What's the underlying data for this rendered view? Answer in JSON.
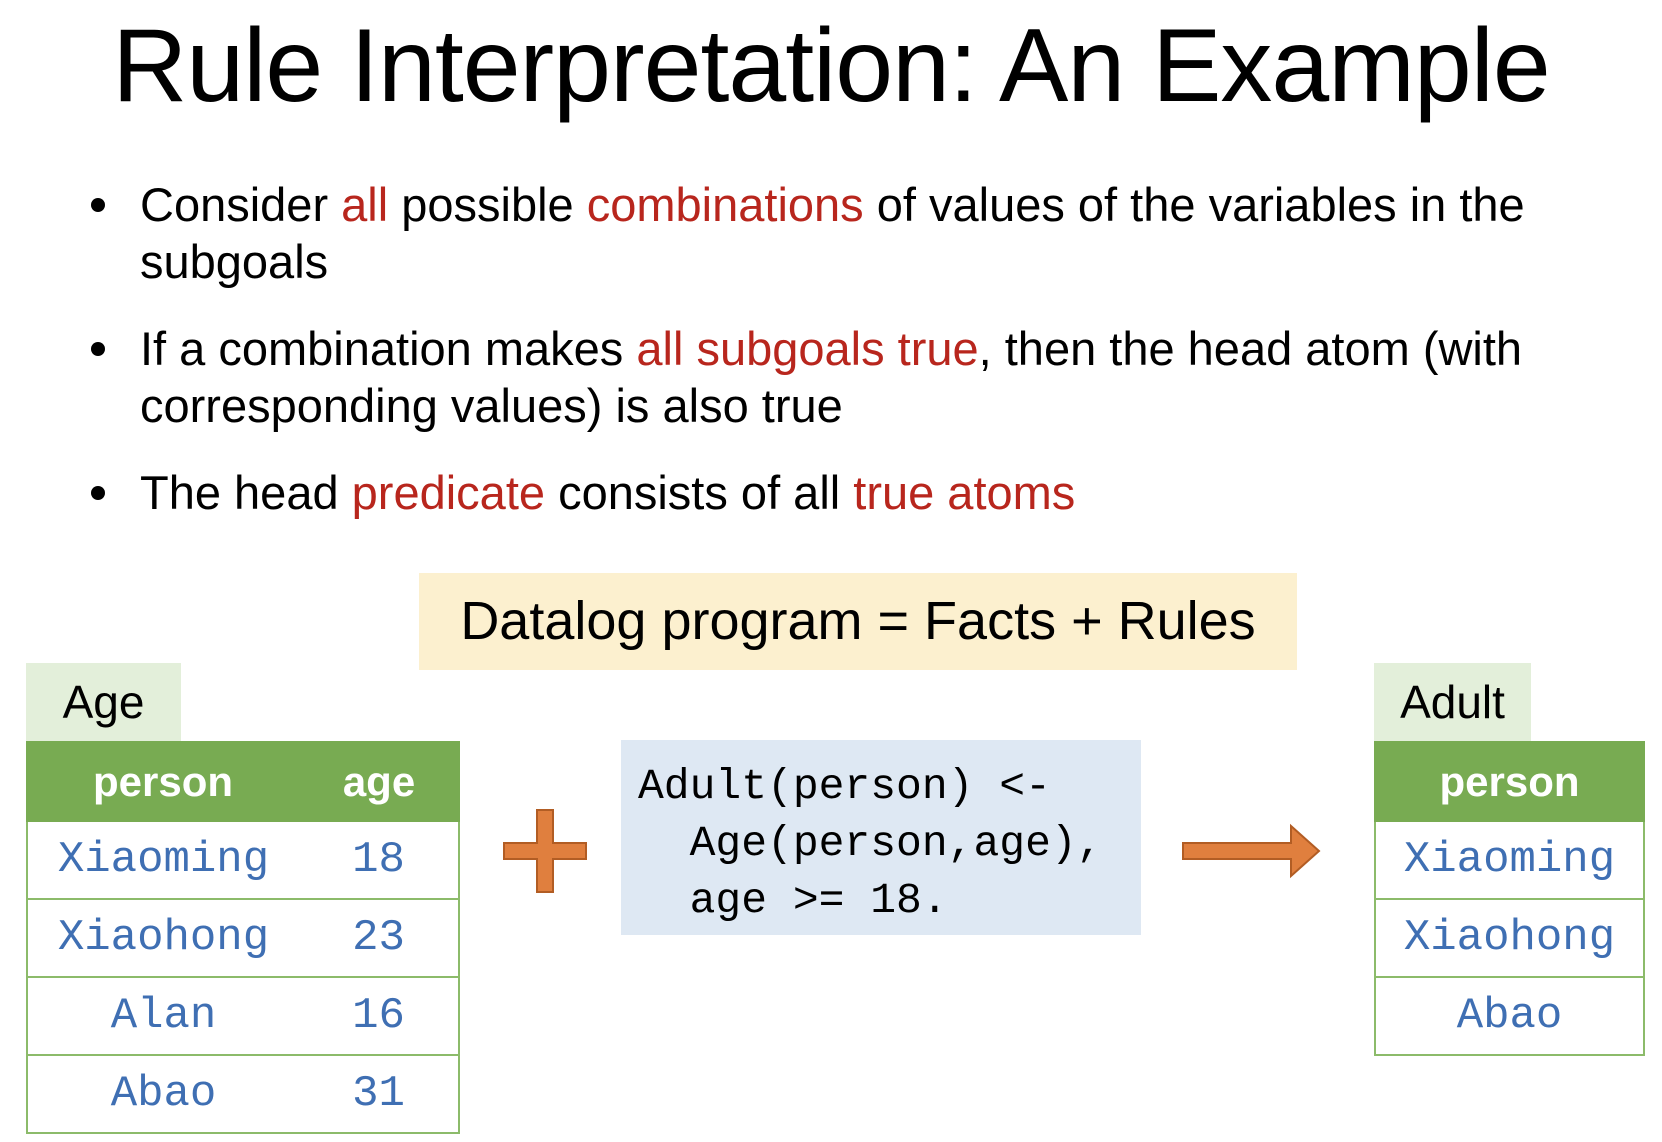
{
  "slide": {
    "title": "Rule Interpretation: An Example",
    "bullets": [
      [
        {
          "text": "Consider ",
          "emph": false
        },
        {
          "text": "all",
          "emph": true
        },
        {
          "text": " possible ",
          "emph": false
        },
        {
          "text": "combinations",
          "emph": true
        },
        {
          "text": " of values of the variables in the subgoals",
          "emph": false
        }
      ],
      [
        {
          "text": "If a combination makes ",
          "emph": false
        },
        {
          "text": "all subgoals true",
          "emph": true
        },
        {
          "text": ", then the head atom (with corresponding values) is also true",
          "emph": false
        }
      ],
      [
        {
          "text": "The head ",
          "emph": false
        },
        {
          "text": "predicate",
          "emph": true
        },
        {
          "text": " consists of all ",
          "emph": false
        },
        {
          "text": "true atoms",
          "emph": true
        }
      ]
    ],
    "banner": "Datalog program = Facts + Rules",
    "age_table": {
      "tab": "Age",
      "headers": [
        "person",
        "age"
      ],
      "rows": [
        [
          "Xiaoming",
          "18"
        ],
        [
          "Xiaohong",
          "23"
        ],
        [
          "Alan",
          "16"
        ],
        [
          "Abao",
          "31"
        ]
      ]
    },
    "plus_icon": "plus-icon",
    "rule": {
      "lines": [
        "Adult(person) <-",
        "  Age(person,age),",
        "  age >= 18."
      ]
    },
    "arrow_icon": "right-arrow-icon",
    "adult_table": {
      "tab": "Adult",
      "headers": [
        "person"
      ],
      "rows": [
        [
          "Xiaoming"
        ],
        [
          "Xiaohong"
        ],
        [
          "Abao"
        ]
      ]
    },
    "colors": {
      "emphasis": "#b8261d",
      "banner_bg": "#fcf0cf",
      "table_header": "#78ab52",
      "table_tab": "#e3efda",
      "table_text": "#3f6fb3",
      "code_bg": "#dee8f3",
      "shape_fill": "#e07f3e",
      "shape_stroke": "#b25d24"
    }
  }
}
